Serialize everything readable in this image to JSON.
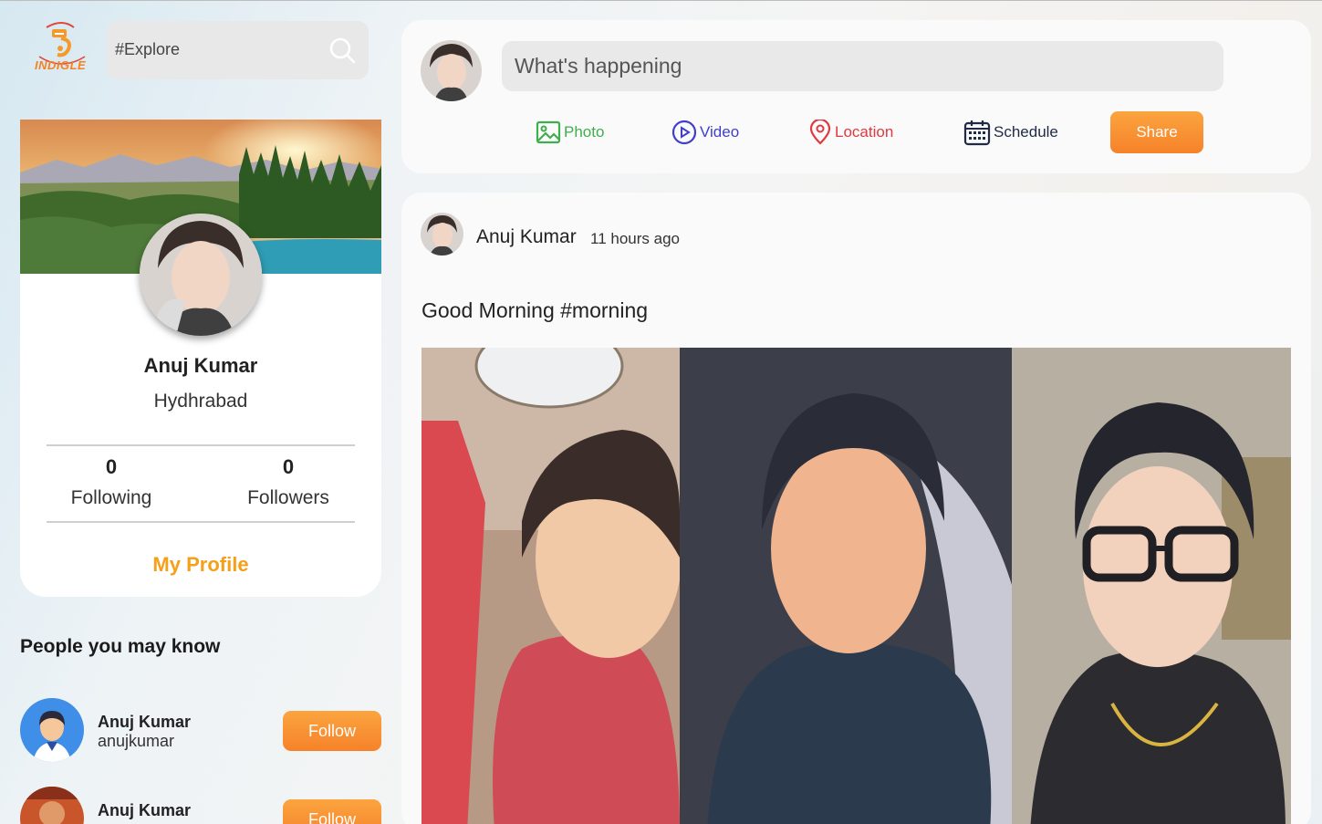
{
  "app": {
    "logo_text": "INDIGLE",
    "brand_color": "#f6822a"
  },
  "search": {
    "placeholder": "#Explore",
    "icon": "search-icon"
  },
  "profile": {
    "name": "Anuj Kumar",
    "city": "Hydhrabad",
    "following_count": "0",
    "following_label": "Following",
    "followers_count": "0",
    "followers_label": "Followers",
    "my_profile_label": "My Profile"
  },
  "people": {
    "title": "People you may know",
    "items": [
      {
        "name": "Anuj Kumar",
        "username": "anujkumar",
        "follow_label": "Follow"
      },
      {
        "name": "Anuj Kumar",
        "username": "",
        "follow_label": "Follow"
      }
    ]
  },
  "composer": {
    "placeholder": "What's happening",
    "options": [
      {
        "label": "Photo",
        "icon": "image-icon",
        "color": "#3fae4d"
      },
      {
        "label": "Video",
        "icon": "play-circle-icon",
        "color": "#3f3fc8"
      },
      {
        "label": "Location",
        "icon": "map-pin-icon",
        "color": "#e2383f"
      },
      {
        "label": "Schedule",
        "icon": "calendar-icon",
        "color": "#1f2a44"
      }
    ],
    "share_label": "Share"
  },
  "post": {
    "author": "Anuj Kumar",
    "time": "11 hours ago",
    "text": "Good Morning #morning"
  }
}
